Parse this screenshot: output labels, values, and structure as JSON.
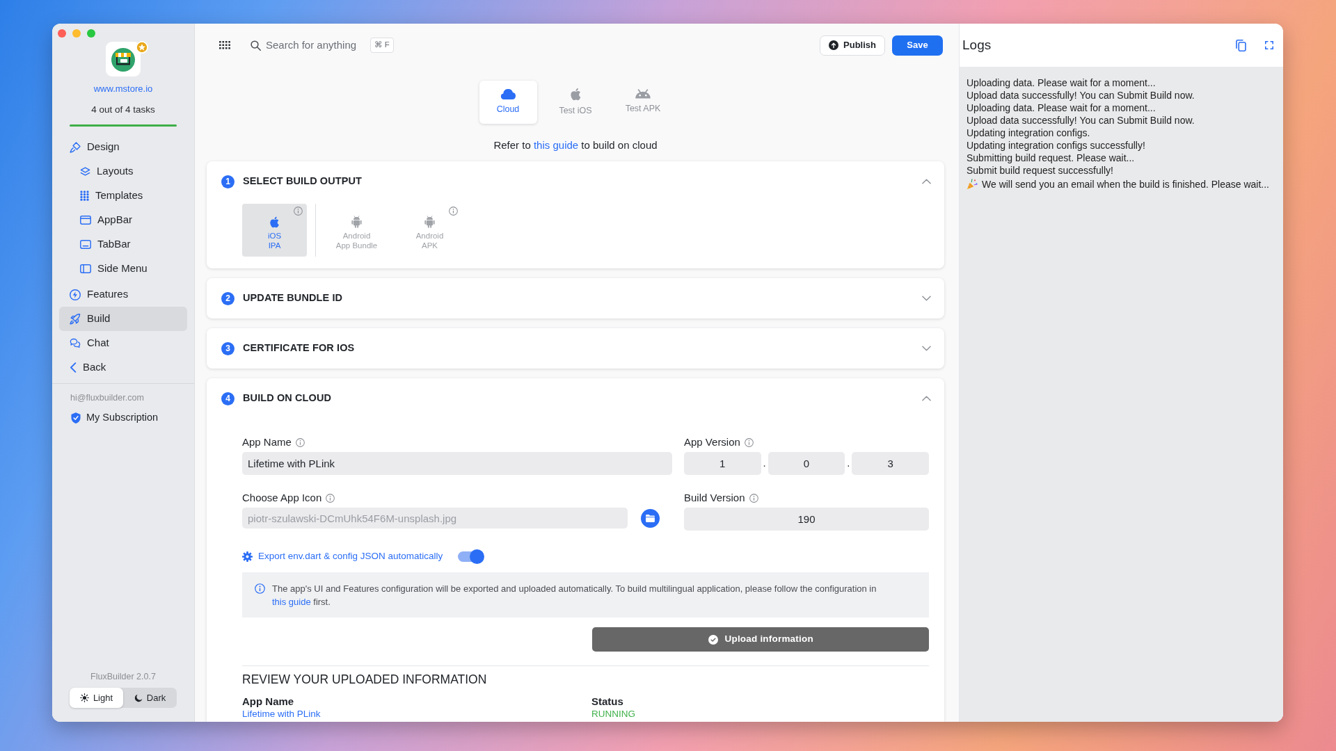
{
  "sidebar": {
    "site_link": "www.mstore.io",
    "tasks": "4 out of 4 tasks",
    "tasks_progress": {
      "level": 1
    },
    "items": [
      {
        "label": "Design",
        "selected": false,
        "children": [
          {
            "label": "Layouts",
            "selected": false
          },
          {
            "label": "Templates",
            "selected": false
          },
          {
            "label": "AppBar",
            "selected": false
          },
          {
            "label": "TabBar",
            "selected": false
          },
          {
            "label": "Side Menu",
            "selected": false
          }
        ]
      },
      {
        "label": "Features",
        "selected": false
      },
      {
        "label": "Build",
        "selected": true
      },
      {
        "label": "Chat",
        "selected": false
      },
      {
        "label": "Back",
        "selected": false
      }
    ],
    "email": "hi@fluxbuilder.com",
    "subscription": "My Subscription",
    "version": "FluxBuilder 2.0.7",
    "theme_options": [
      {
        "label": "Light",
        "selected": true
      },
      {
        "label": "Dark",
        "selected": false
      }
    ]
  },
  "topbar": {
    "search": {
      "placeholder": "Search for anything"
    },
    "shortcut": "⌘ F",
    "buttons": [
      {
        "label": "Publish",
        "kind": "outline"
      },
      {
        "label": "Save",
        "kind": "primary"
      }
    ]
  },
  "build_targets": [
    {
      "label": "Cloud",
      "kind": "cloud",
      "selected": true
    },
    {
      "label": "Test iOS",
      "kind": "ios",
      "selected": false
    },
    {
      "label": "Test APK",
      "kind": "android",
      "selected": false
    }
  ],
  "guide_note": {
    "before": "Refer to",
    "link": "this guide",
    "after": "to build on cloud"
  },
  "sections": [
    {
      "number": "1",
      "title": "SELECT BUILD OUTPUT",
      "expanded": true,
      "outputs": [
        {
          "platform": "iOS",
          "format": "IPA",
          "kind": "ios",
          "selected": true,
          "info": true
        },
        {
          "platform": "Android",
          "format": "App Bundle",
          "kind": "android",
          "selected": false,
          "info": false
        },
        {
          "platform": "Android",
          "format": "APK",
          "kind": "android",
          "selected": false,
          "info": true
        }
      ]
    },
    {
      "number": "2",
      "title": "UPDATE BUNDLE ID",
      "expanded": false
    },
    {
      "number": "3",
      "title": "CERTIFICATE FOR IOS",
      "expanded": false
    },
    {
      "number": "4",
      "title": "BUILD ON CLOUD",
      "expanded": true,
      "form": {
        "app_name": {
          "label": "App Name",
          "value": "Lifetime with PLink"
        },
        "app_version": {
          "label": "App Version",
          "parts": [
            "1",
            "0",
            "3"
          ],
          "separator": "."
        },
        "app_icon": {
          "label": "Choose App Icon",
          "placeholder": "piotr-szulawski-DCmUhk54F6M-unsplash.jpg"
        },
        "build_version": {
          "label": "Build Version",
          "value": "190"
        },
        "export_toggle": {
          "label": "Export env.dart & config JSON automatically",
          "on": true
        },
        "notice": {
          "text": "The app's UI and Features configuration will be exported and uploaded automatically. To build multilingual application, please follow the configuration in",
          "link": "this guide",
          "after": "first."
        },
        "upload_button": "Upload information"
      },
      "review": {
        "title": "REVIEW YOUR UPLOADED INFORMATION",
        "fields": [
          {
            "label": "App Name",
            "value": "Lifetime with PLink",
            "kind": "link"
          },
          {
            "label": "Status",
            "value": "RUNNING",
            "kind": "status"
          }
        ]
      }
    }
  ],
  "logs": {
    "title": "Logs",
    "lines": [
      {
        "text": "Uploading data. Please wait for a moment...",
        "kind": "plain"
      },
      {
        "text": "Upload data successfully! You can Submit Build now.",
        "kind": "plain"
      },
      {
        "text": "Uploading data. Please wait for a moment...",
        "kind": "plain"
      },
      {
        "text": "Upload data successfully! You can Submit Build now.",
        "kind": "plain"
      },
      {
        "text": "Updating integration configs.",
        "kind": "plain"
      },
      {
        "text": "Updating integration configs successfully!",
        "kind": "plain"
      },
      {
        "text": "Submitting build request. Please wait...",
        "kind": "plain"
      },
      {
        "text": "Submit build request successfully!",
        "kind": "plain"
      },
      {
        "text": "We will send you an email when the build is finished. Please wait...",
        "kind": "celebration"
      }
    ]
  }
}
